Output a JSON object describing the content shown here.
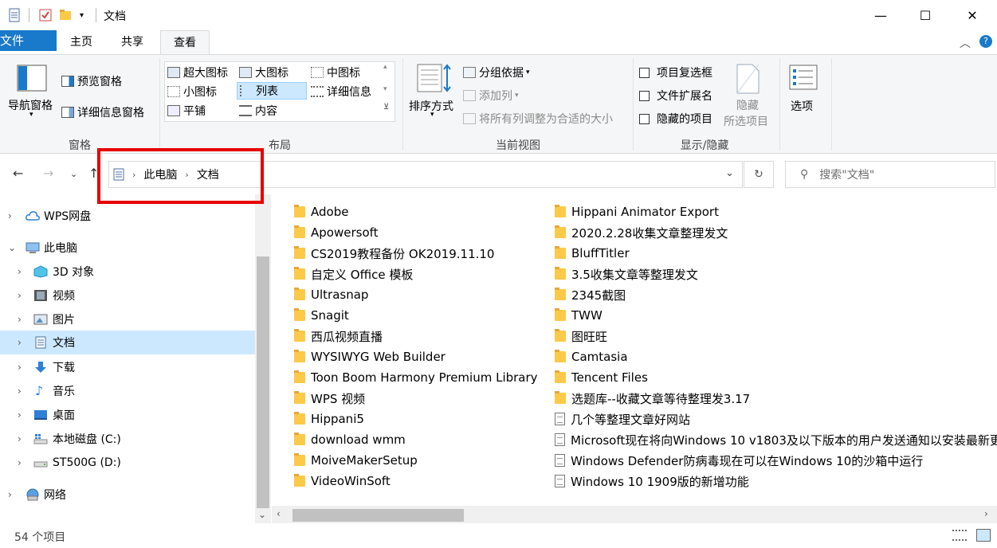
{
  "window": {
    "title": "文档",
    "minimize_glyph": "—",
    "maximize_glyph": "☐",
    "close_glyph": "✕"
  },
  "tabs": {
    "file": "文件",
    "home": "主页",
    "share": "共享",
    "view": "查看"
  },
  "ribbon": {
    "pane": {
      "nav_pane": "导航窗格",
      "preview_pane": "预览窗格",
      "details_pane": "详细信息窗格",
      "label": "窗格"
    },
    "layout": {
      "extra_large": "超大图标",
      "large": "大图标",
      "medium": "中图标",
      "small": "小图标",
      "list": "列表",
      "details": "详细信息",
      "tiles": "平铺",
      "content": "内容",
      "label": "布局"
    },
    "current_view": {
      "sort_by": "排序方式",
      "group_by": "分组依据",
      "add_column": "添加列",
      "fit_columns": "将所有列调整为合适的大小",
      "label": "当前视图"
    },
    "show_hide": {
      "item_checkboxes": "项目复选框",
      "file_extensions": "文件扩展名",
      "hidden_items": "隐藏的项目",
      "hide_selected_1": "隐藏",
      "hide_selected_2": "所选项目",
      "label": "显示/隐藏"
    },
    "options": "选项"
  },
  "address": {
    "crumb_1": "此电脑",
    "crumb_2": "文档",
    "search_placeholder": "搜索\"文档\""
  },
  "nav_tree": [
    {
      "label": "WPS网盘"
    },
    {
      "label": "此电脑"
    },
    {
      "label": "3D 对象"
    },
    {
      "label": "视频"
    },
    {
      "label": "图片"
    },
    {
      "label": "文档"
    },
    {
      "label": "下载"
    },
    {
      "label": "音乐"
    },
    {
      "label": "桌面"
    },
    {
      "label": "本地磁盘 (C:)"
    },
    {
      "label": "ST500G (D:)"
    },
    {
      "label": "网络"
    }
  ],
  "files_col1": [
    "Adobe",
    "Apowersoft",
    "CS2019教程备份 OK2019.11.10",
    "自定义 Office 模板",
    "Ultrasnap",
    "Snagit",
    "西瓜视频直播",
    "WYSIWYG Web Builder",
    "Toon Boom Harmony Premium Library",
    "WPS 视频",
    "Hippani5",
    "download  wmm",
    "MoiveMakerSetup",
    "VideoWinSoft"
  ],
  "files_col2": [
    "Hippani Animator Export",
    "2020.2.28收集文章整理发文",
    "BluffTitler",
    "3.5收集文章等整理发文",
    "2345截图",
    "TWW",
    "图旺旺",
    "Camtasia",
    "Tencent Files",
    "选题库--收藏文章等待整理发3.17",
    "几个等整理文章好网站",
    "Microsoft现在将向Windows 10 v1803及以下版本的用户发送通知以安装最新更",
    "Windows Defender防病毒现在可以在Windows 10的沙箱中运行",
    "Windows 10 1909版的新增功能"
  ],
  "status": {
    "count": "54 个项目"
  },
  "colors": {
    "accent": "#1979ca",
    "selection": "#cce8ff",
    "highlight_box": "#e60000"
  }
}
